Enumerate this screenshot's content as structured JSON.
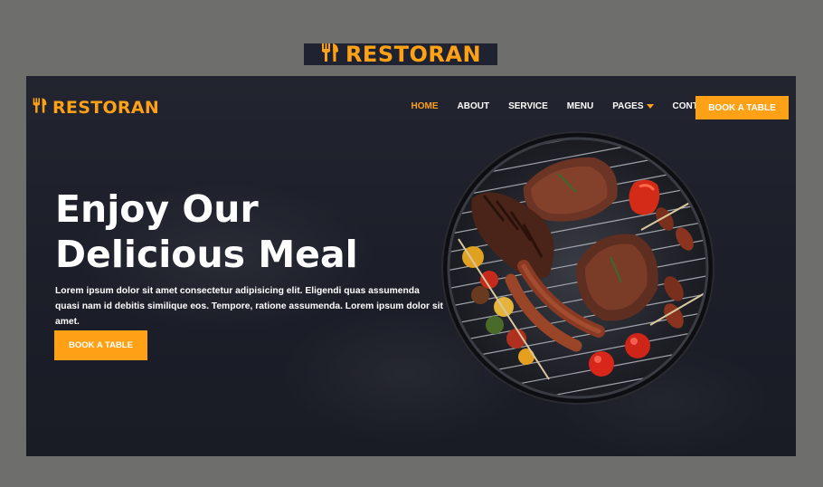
{
  "brand": {
    "name": "RESTORAN",
    "icon": "utensils-icon",
    "accent_color": "#fea116",
    "dark_color": "#0f172b"
  },
  "nav": {
    "items": [
      {
        "label": "HOME",
        "active": true
      },
      {
        "label": "ABOUT",
        "active": false
      },
      {
        "label": "SERVICE",
        "active": false
      },
      {
        "label": "MENU",
        "active": false
      },
      {
        "label": "PAGES",
        "active": false,
        "dropdown": true
      },
      {
        "label": "CONTACT",
        "active": false
      }
    ],
    "cta_label": "BOOK A TABLE"
  },
  "hero": {
    "headline_line1": "Enjoy Our",
    "headline_line2": "Delicious Meal",
    "lead": "Lorem ipsum dolor sit amet consectetur adipisicing elit. Eligendi quas assumenda quasi nam id debitis similique eos. Tempore, ratione assumenda. Lorem ipsum dolor sit amet.",
    "cta_label": "BOOK A TABLE",
    "image": "bbq-grill-image"
  }
}
